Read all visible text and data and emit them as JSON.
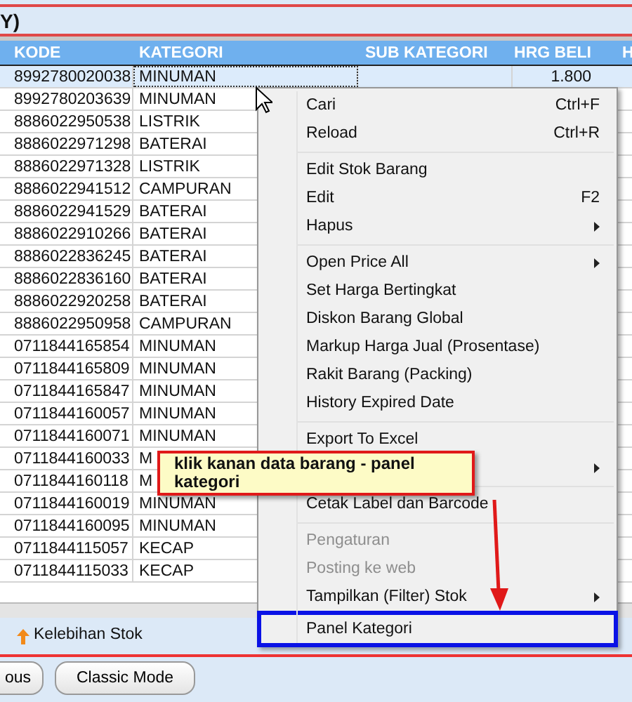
{
  "title_bar": {
    "title": "Y)"
  },
  "table": {
    "columns": [
      "KODE",
      "KATEGORI",
      "SUB KATEGORI",
      "HRG BELI",
      "H"
    ],
    "rows": [
      {
        "kode": "8992780020038",
        "kategori": "MINUMAN",
        "hrg_beli": "1.800",
        "selected": true
      },
      {
        "kode": "8992780203639",
        "kategori": "MINUMAN",
        "selected": false
      },
      {
        "kode": "8886022950538",
        "kategori": "LISTRIK",
        "selected": false
      },
      {
        "kode": "8886022971298",
        "kategori": "BATERAI",
        "selected": false
      },
      {
        "kode": "8886022971328",
        "kategori": "LISTRIK",
        "selected": false
      },
      {
        "kode": "8886022941512",
        "kategori": "CAMPURAN",
        "selected": false
      },
      {
        "kode": "8886022941529",
        "kategori": "BATERAI",
        "selected": false
      },
      {
        "kode": "8886022910266",
        "kategori": "BATERAI",
        "selected": false
      },
      {
        "kode": "8886022836245",
        "kategori": "BATERAI",
        "selected": false
      },
      {
        "kode": "8886022836160",
        "kategori": "BATERAI",
        "selected": false
      },
      {
        "kode": "8886022920258",
        "kategori": "BATERAI",
        "selected": false
      },
      {
        "kode": "8886022950958",
        "kategori": "CAMPURAN",
        "selected": false
      },
      {
        "kode": "0711844165854",
        "kategori": "MINUMAN",
        "selected": false
      },
      {
        "kode": "0711844165809",
        "kategori": "MINUMAN",
        "selected": false
      },
      {
        "kode": "0711844165847",
        "kategori": "MINUMAN",
        "selected": false
      },
      {
        "kode": "0711844160057",
        "kategori": "MINUMAN",
        "selected": false
      },
      {
        "kode": "0711844160071",
        "kategori": "MINUMAN",
        "selected": false
      },
      {
        "kode": "0711844160033",
        "kategori": "M",
        "selected": false
      },
      {
        "kode": "0711844160118",
        "kategori": "M",
        "selected": false
      },
      {
        "kode": "0711844160019",
        "kategori": "MINUMAN",
        "selected": false
      },
      {
        "kode": "0711844160095",
        "kategori": "MINUMAN",
        "selected": false
      },
      {
        "kode": "0711844115057",
        "kategori": "KECAP",
        "selected": false
      },
      {
        "kode": "0711844115033",
        "kategori": "KECAP",
        "selected": false
      }
    ]
  },
  "context_menu": {
    "items": [
      {
        "kind": "item",
        "label": "Cari",
        "shortcut": "Ctrl+F",
        "submenu": false,
        "disabled": false,
        "marked": false
      },
      {
        "kind": "item",
        "label": "Reload",
        "shortcut": "Ctrl+R",
        "submenu": false,
        "disabled": false,
        "marked": false
      },
      {
        "kind": "separator"
      },
      {
        "kind": "item",
        "label": "Edit Stok Barang",
        "submenu": false,
        "disabled": false,
        "marked": false
      },
      {
        "kind": "item",
        "label": "Edit",
        "shortcut": "F2",
        "submenu": false,
        "disabled": false,
        "marked": false
      },
      {
        "kind": "item",
        "label": "Hapus",
        "submenu": true,
        "disabled": false,
        "marked": false
      },
      {
        "kind": "separator"
      },
      {
        "kind": "item",
        "label": "Open Price All",
        "submenu": true,
        "disabled": false,
        "marked": false
      },
      {
        "kind": "item",
        "label": "Set Harga Bertingkat",
        "submenu": false,
        "disabled": false,
        "marked": false
      },
      {
        "kind": "item",
        "label": "Diskon Barang Global",
        "submenu": false,
        "disabled": false,
        "marked": false
      },
      {
        "kind": "item",
        "label": "Markup Harga Jual (Prosentase)",
        "submenu": false,
        "disabled": false,
        "marked": false
      },
      {
        "kind": "item",
        "label": "Rakit Barang (Packing)",
        "submenu": false,
        "disabled": false,
        "marked": false
      },
      {
        "kind": "item",
        "label": "History Expired Date",
        "submenu": false,
        "disabled": false,
        "marked": false
      },
      {
        "kind": "separator"
      },
      {
        "kind": "item",
        "label": "Export To Excel",
        "submenu": false,
        "disabled": false,
        "marked": false
      },
      {
        "kind": "item",
        "submenu": true,
        "disabled": false,
        "marked": false
      },
      {
        "kind": "separator"
      },
      {
        "kind": "item",
        "label": "Cetak Label dan Barcode",
        "submenu": false,
        "disabled": false,
        "marked": false
      },
      {
        "kind": "separator"
      },
      {
        "kind": "item",
        "label": "Pengaturan",
        "submenu": false,
        "disabled": true,
        "marked": false
      },
      {
        "kind": "item",
        "label": "Posting ke web",
        "submenu": false,
        "disabled": true,
        "marked": false
      },
      {
        "kind": "item",
        "label": "Tampilkan (Filter) Stok",
        "submenu": true,
        "disabled": false,
        "marked": false
      },
      {
        "kind": "item",
        "label": "Panel Kategori",
        "submenu": false,
        "disabled": false,
        "marked": true
      }
    ]
  },
  "callout": {
    "text": "klik kanan data barang - panel kategori"
  },
  "status_bar": {
    "legend": "Kelebihan Stok"
  },
  "buttons": [
    "ous",
    "Classic Mode"
  ]
}
